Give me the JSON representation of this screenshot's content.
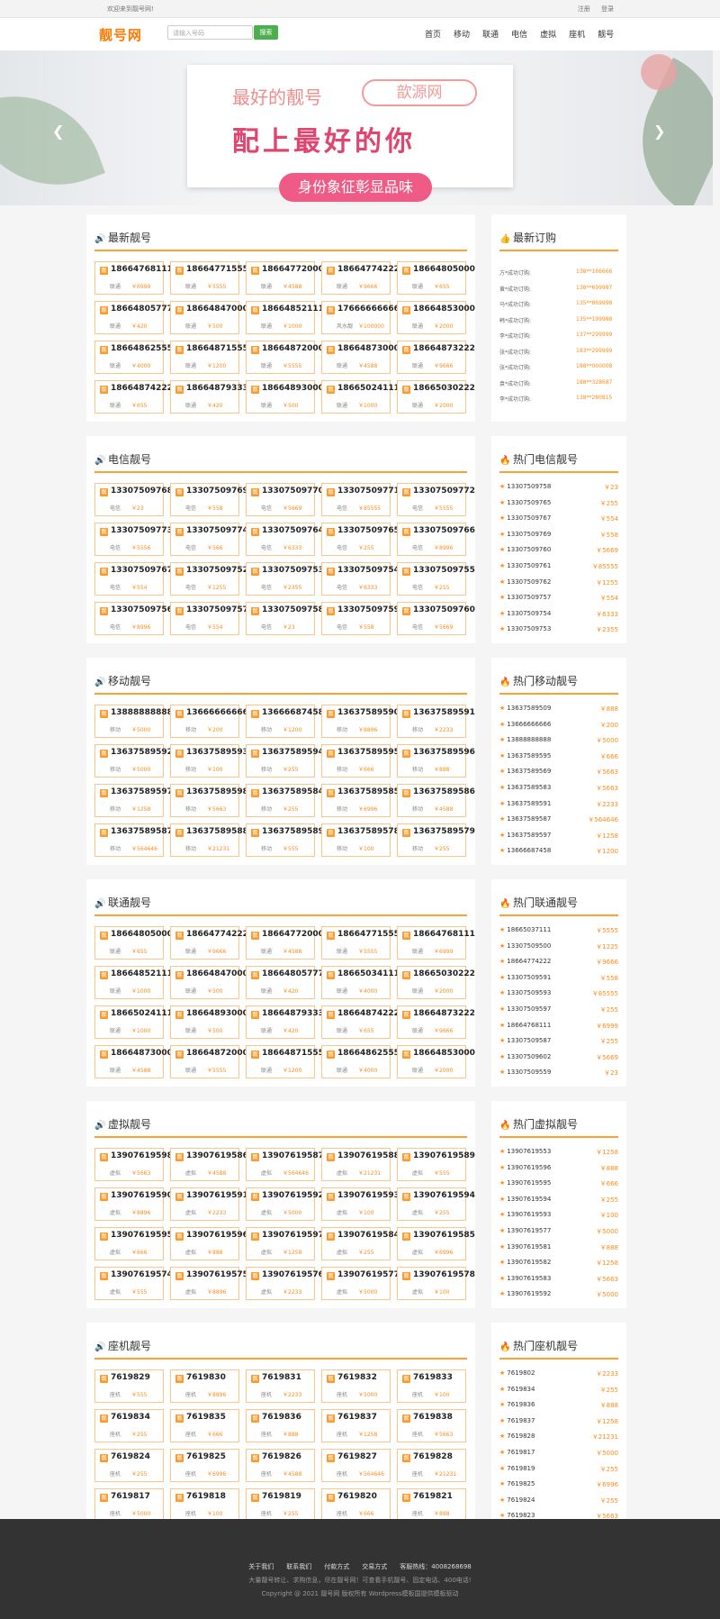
{
  "topbar": {
    "welcome": "欢迎来到靓号网!",
    "register": "注册",
    "login": "登录"
  },
  "header": {
    "logo": "靓号网",
    "search_placeholder": "请输入号码",
    "search_button": "搜索",
    "nav": [
      "首页",
      "移动",
      "联通",
      "电信",
      "虚拟",
      "座机",
      "靓号"
    ]
  },
  "banner": {
    "line1": "最好的靓号",
    "bubble": "歆源网",
    "line2": "配上最好的你",
    "pill": "身份象征彰显品味"
  },
  "sections": [
    {
      "title": "最新靓号",
      "items": [
        [
          "18664768111",
          "联通",
          "￥6999"
        ],
        [
          "18664771555",
          "联通",
          "￥5555"
        ],
        [
          "18664772000",
          "联通",
          "￥4588"
        ],
        [
          "18664774222",
          "联通",
          "￥9666"
        ],
        [
          "18664805000",
          "联通",
          "￥655"
        ],
        [
          "18664805777",
          "联通",
          "￥420"
        ],
        [
          "18664847000",
          "联通",
          "￥500"
        ],
        [
          "18664852111",
          "联通",
          "￥1000"
        ],
        [
          "17666666666",
          "风水靓",
          "￥100000"
        ],
        [
          "18664853000",
          "联通",
          "￥2000"
        ],
        [
          "18664862555",
          "联通",
          "￥4000"
        ],
        [
          "18664871555",
          "联通",
          "￥1200"
        ],
        [
          "18664872000",
          "联通",
          "￥5555"
        ],
        [
          "18664873000",
          "联通",
          "￥4588"
        ],
        [
          "18664873222",
          "联通",
          "￥9666"
        ],
        [
          "18664874222",
          "联通",
          "￥655"
        ],
        [
          "18664879333",
          "联通",
          "￥420"
        ],
        [
          "18664893000",
          "联通",
          "￥500"
        ],
        [
          "18665024111",
          "联通",
          "￥1000"
        ],
        [
          "18665030222",
          "联通",
          "￥2000"
        ]
      ]
    },
    {
      "title": "电信靓号",
      "items": [
        [
          "13307509768",
          "电信",
          "￥23"
        ],
        [
          "13307509769",
          "电信",
          "￥558"
        ],
        [
          "13307509770",
          "电信",
          "￥5669"
        ],
        [
          "13307509771",
          "电信",
          "￥85555"
        ],
        [
          "13307509772",
          "电信",
          "￥5555"
        ],
        [
          "13307509773",
          "电信",
          "￥5556"
        ],
        [
          "13307509774",
          "电信",
          "￥566"
        ],
        [
          "13307509764",
          "电信",
          "￥6333"
        ],
        [
          "13307509765",
          "电信",
          "￥255"
        ],
        [
          "13307509766",
          "电信",
          "￥8996"
        ],
        [
          "13307509767",
          "电信",
          "￥554"
        ],
        [
          "13307509752",
          "电信",
          "￥1255"
        ],
        [
          "13307509753",
          "电信",
          "￥2355"
        ],
        [
          "13307509754",
          "电信",
          "￥6333"
        ],
        [
          "13307509755",
          "电信",
          "￥255"
        ],
        [
          "13307509756",
          "电信",
          "￥8996"
        ],
        [
          "13307509757",
          "电信",
          "￥554"
        ],
        [
          "13307509758",
          "电信",
          "￥23"
        ],
        [
          "13307509759",
          "电信",
          "￥558"
        ],
        [
          "13307509760",
          "电信",
          "￥5669"
        ]
      ]
    },
    {
      "title": "移动靓号",
      "items": [
        [
          "13888888888",
          "移动",
          "￥5000"
        ],
        [
          "13666666666",
          "移动",
          "￥200"
        ],
        [
          "13666687458",
          "移动",
          "￥1200"
        ],
        [
          "13637589590",
          "移动",
          "￥8896"
        ],
        [
          "13637589591",
          "移动",
          "￥2233"
        ],
        [
          "13637589592",
          "移动",
          "￥5000"
        ],
        [
          "13637589593",
          "移动",
          "￥100"
        ],
        [
          "13637589594",
          "移动",
          "￥255"
        ],
        [
          "13637589595",
          "移动",
          "￥666"
        ],
        [
          "13637589596",
          "移动",
          "￥888"
        ],
        [
          "13637589597",
          "移动",
          "￥1258"
        ],
        [
          "13637589598",
          "移动",
          "￥5663"
        ],
        [
          "13637589584",
          "移动",
          "￥255"
        ],
        [
          "13637589585",
          "移动",
          "￥6996"
        ],
        [
          "13637589586",
          "移动",
          "￥4588"
        ],
        [
          "13637589587",
          "移动",
          "￥564646"
        ],
        [
          "13637589588",
          "移动",
          "￥21231"
        ],
        [
          "13637589589",
          "移动",
          "￥555"
        ],
        [
          "13637589578",
          "移动",
          "￥100"
        ],
        [
          "13637589579",
          "移动",
          "￥255"
        ]
      ]
    },
    {
      "title": "联通靓号",
      "items": [
        [
          "18664805000",
          "联通",
          "￥655"
        ],
        [
          "18664774222",
          "联通",
          "￥9666"
        ],
        [
          "18664772000",
          "联通",
          "￥4588"
        ],
        [
          "18664771555",
          "联通",
          "￥5555"
        ],
        [
          "18664768111",
          "联通",
          "￥6999"
        ],
        [
          "18664852111",
          "联通",
          "￥1000"
        ],
        [
          "18664847000",
          "联通",
          "￥500"
        ],
        [
          "18664805777",
          "联通",
          "￥420"
        ],
        [
          "18665034111",
          "联通",
          "￥4000"
        ],
        [
          "18665030222",
          "联通",
          "￥2000"
        ],
        [
          "18665024111",
          "联通",
          "￥1000"
        ],
        [
          "18664893000",
          "联通",
          "￥500"
        ],
        [
          "18664879333",
          "联通",
          "￥420"
        ],
        [
          "18664874222",
          "联通",
          "￥655"
        ],
        [
          "18664873222",
          "联通",
          "￥9666"
        ],
        [
          "18664873000",
          "联通",
          "￥4588"
        ],
        [
          "18664872000",
          "联通",
          "￥5555"
        ],
        [
          "18664871555",
          "联通",
          "￥1200"
        ],
        [
          "18664862555",
          "联通",
          "￥4000"
        ],
        [
          "18664853000",
          "联通",
          "￥2000"
        ]
      ]
    },
    {
      "title": "虚拟靓号",
      "items": [
        [
          "13907619598",
          "虚拟",
          "￥5663"
        ],
        [
          "13907619586",
          "虚拟",
          "￥4588"
        ],
        [
          "13907619587",
          "虚拟",
          "￥564646"
        ],
        [
          "13907619588",
          "虚拟",
          "￥21231"
        ],
        [
          "13907619589",
          "虚拟",
          "￥555"
        ],
        [
          "13907619590",
          "虚拟",
          "￥8896"
        ],
        [
          "13907619591",
          "虚拟",
          "￥2233"
        ],
        [
          "13907619592",
          "虚拟",
          "￥5000"
        ],
        [
          "13907619593",
          "虚拟",
          "￥100"
        ],
        [
          "13907619594",
          "虚拟",
          "￥255"
        ],
        [
          "13907619595",
          "虚拟",
          "￥666"
        ],
        [
          "13907619596",
          "虚拟",
          "￥888"
        ],
        [
          "13907619597",
          "虚拟",
          "￥1258"
        ],
        [
          "13907619584",
          "虚拟",
          "￥255"
        ],
        [
          "13907619585",
          "虚拟",
          "￥6996"
        ],
        [
          "13907619574",
          "虚拟",
          "￥555"
        ],
        [
          "13907619575",
          "虚拟",
          "￥8896"
        ],
        [
          "13907619576",
          "虚拟",
          "￥2233"
        ],
        [
          "13907619577",
          "虚拟",
          "￥5000"
        ],
        [
          "13907619578",
          "虚拟",
          "￥100"
        ]
      ]
    },
    {
      "title": "座机靓号",
      "items": [
        [
          "7619829",
          "座机",
          "￥555"
        ],
        [
          "7619830",
          "座机",
          "￥8896"
        ],
        [
          "7619831",
          "座机",
          "￥2233"
        ],
        [
          "7619832",
          "座机",
          "￥5000"
        ],
        [
          "7619833",
          "座机",
          "￥100"
        ],
        [
          "7619834",
          "座机",
          "￥255"
        ],
        [
          "7619835",
          "座机",
          "￥666"
        ],
        [
          "7619836",
          "座机",
          "￥888"
        ],
        [
          "7619837",
          "座机",
          "￥1258"
        ],
        [
          "7619838",
          "座机",
          "￥5663"
        ],
        [
          "7619824",
          "座机",
          "￥255"
        ],
        [
          "7619825",
          "座机",
          "￥6996"
        ],
        [
          "7619826",
          "座机",
          "￥4588"
        ],
        [
          "7619827",
          "座机",
          "￥564646"
        ],
        [
          "7619828",
          "座机",
          "￥21231"
        ],
        [
          "7619817",
          "座机",
          "￥5000"
        ],
        [
          "7619818",
          "座机",
          "￥100"
        ],
        [
          "7619819",
          "座机",
          "￥255"
        ],
        [
          "7619820",
          "座机",
          "￥666"
        ],
        [
          "7619821",
          "座机",
          "￥888"
        ]
      ]
    }
  ],
  "latest_orders": {
    "title": "最新订购",
    "rows": [
      [
        "方*成功订购:",
        "138**166666"
      ],
      [
        "黄*成功订购:",
        "138**699987"
      ],
      [
        "马*成功订购:",
        "135**869998"
      ],
      [
        "韩*成功订购:",
        "135**199988"
      ],
      [
        "李*成功订购:",
        "137**299999"
      ],
      [
        "张*成功订购:",
        "183**299999"
      ],
      [
        "张*成功订购:",
        "188**000008"
      ],
      [
        "袁*成功订购:",
        "188**328687"
      ],
      [
        "李*成功订购:",
        "138**280815"
      ]
    ]
  },
  "hot_lists": [
    {
      "title": "热门电信靓号",
      "rows": [
        [
          "13307509758",
          "￥23"
        ],
        [
          "13307509765",
          "￥255"
        ],
        [
          "13307509767",
          "￥554"
        ],
        [
          "13307509769",
          "￥558"
        ],
        [
          "13307509760",
          "￥5669"
        ],
        [
          "13307509761",
          "￥85555"
        ],
        [
          "13307509762",
          "￥1255"
        ],
        [
          "13307509757",
          "￥554"
        ],
        [
          "13307509754",
          "￥6333"
        ],
        [
          "13307509753",
          "￥2355"
        ]
      ]
    },
    {
      "title": "热门移动靓号",
      "rows": [
        [
          "13637589509",
          "￥888"
        ],
        [
          "13666666666",
          "￥200"
        ],
        [
          "13888888888",
          "￥5000"
        ],
        [
          "13637589595",
          "￥666"
        ],
        [
          "13637589569",
          "￥5663"
        ],
        [
          "13637589583",
          "￥5663"
        ],
        [
          "13637589591",
          "￥2233"
        ],
        [
          "13637589587",
          "￥564646"
        ],
        [
          "13637589597",
          "￥1258"
        ],
        [
          "13666687458",
          "￥1200"
        ]
      ]
    },
    {
      "title": "热门联通靓号",
      "rows": [
        [
          "18665037111",
          "￥5555"
        ],
        [
          "13307509500",
          "￥1225"
        ],
        [
          "18664774222",
          "￥9666"
        ],
        [
          "13307509591",
          "￥558"
        ],
        [
          "13307509593",
          "￥85555"
        ],
        [
          "13307509597",
          "￥255"
        ],
        [
          "18664768111",
          "￥6999"
        ],
        [
          "13307509587",
          "￥255"
        ],
        [
          "13307509602",
          "￥5669"
        ],
        [
          "13307509559",
          "￥23"
        ]
      ]
    },
    {
      "title": "热门虚拟靓号",
      "rows": [
        [
          "13907619553",
          "￥1258"
        ],
        [
          "13907619596",
          "￥888"
        ],
        [
          "13907619595",
          "￥666"
        ],
        [
          "13907619594",
          "￥255"
        ],
        [
          "13907619593",
          "￥100"
        ],
        [
          "13907619577",
          "￥5000"
        ],
        [
          "13907619581",
          "￥888"
        ],
        [
          "13907619582",
          "￥1258"
        ],
        [
          "13907619583",
          "￥5663"
        ],
        [
          "13907619592",
          "￥5000"
        ]
      ]
    },
    {
      "title": "热门座机靓号",
      "rows": [
        [
          "7619802",
          "￥2233"
        ],
        [
          "7619834",
          "￥255"
        ],
        [
          "7619836",
          "￥888"
        ],
        [
          "7619837",
          "￥1258"
        ],
        [
          "7619828",
          "￥21231"
        ],
        [
          "7619817",
          "￥5000"
        ],
        [
          "7619819",
          "￥255"
        ],
        [
          "7619825",
          "￥6996"
        ],
        [
          "7619824",
          "￥255"
        ],
        [
          "7619823",
          "￥5663"
        ]
      ]
    }
  ],
  "footer": {
    "links": [
      "关于我们",
      "联系我们",
      "付款方式",
      "交易方式",
      "客服热线：4008268698"
    ],
    "desc": "大量靓号转让、求购信息，尽在靓号网！可查看手机靓号、固定电话、400电话!",
    "copy": "Copyright @ 2021 靓号网 版权所有    Wordpress模板国提供模板驱动"
  },
  "colors": {
    "accent": "#ff8c1a",
    "search_button": "#4cae4c",
    "footer_bg": "#333333"
  }
}
